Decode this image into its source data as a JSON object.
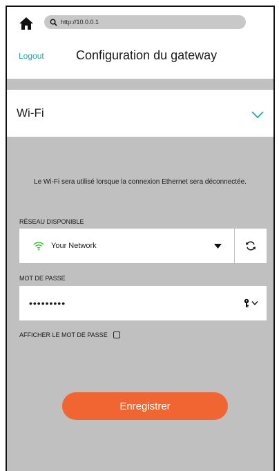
{
  "browser": {
    "url": "http://10.0.0.1",
    "icons": [
      "home-icon",
      "search-icon"
    ]
  },
  "header": {
    "logout_label": "Logout",
    "title": "Configuration du gateway"
  },
  "wifi_section": {
    "title": "Wi-Fi",
    "icon": "chevron-down-icon",
    "info": "Le Wi-Fi sera utilisé lorsque la connexion Ethernet sera déconnectée.",
    "network": {
      "label": "RÉSEAU DISPONIBLE",
      "selected": "Your Network",
      "icons": [
        "wifi-icon",
        "caret-down-icon",
        "refresh-icon"
      ]
    },
    "password": {
      "label": "MOT DE PASSE",
      "value": "•••••••••",
      "icons": [
        "key-icon",
        "chevron-down-icon"
      ]
    },
    "show_password_label": "AFFICHER LE MOT DE PASSE",
    "show_password_checked": false,
    "save_label": "Enregistrer"
  },
  "colors": {
    "accent": "#1aa9a9",
    "button": "#f16533",
    "wifi": "#2ecc2e",
    "panel": "#c0c0c0"
  }
}
